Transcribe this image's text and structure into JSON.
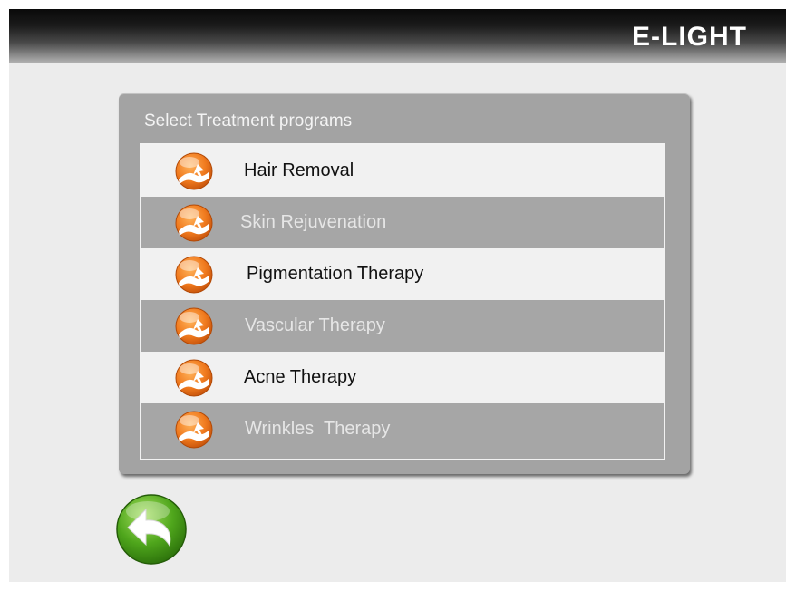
{
  "header": {
    "title": "E-LIGHT"
  },
  "panel": {
    "heading": "Select Treatment programs",
    "items": [
      {
        "label": "Hair Removal",
        "icon": "treatment-icon",
        "style": "light"
      },
      {
        "label": "Skin Rejuvenation",
        "icon": "treatment-icon",
        "style": "dark"
      },
      {
        "label": "Pigmentation Therapy",
        "icon": "treatment-icon",
        "style": "light"
      },
      {
        "label": "Vascular Therapy",
        "icon": "treatment-icon",
        "style": "dark"
      },
      {
        "label": "Acne Therapy",
        "icon": "treatment-icon",
        "style": "light"
      },
      {
        "label": "Wrinkles  Therapy",
        "icon": "treatment-icon",
        "style": "dark"
      }
    ]
  },
  "footer": {
    "back_icon": "back-arrow-icon"
  },
  "colors": {
    "background": "#ececec",
    "panel": "#a3a3a3",
    "row_light": "#f1f1f1",
    "row_dark": "#a6a6a6",
    "icon_orange": "#f07a1e",
    "back_green": "#4fa61c"
  }
}
